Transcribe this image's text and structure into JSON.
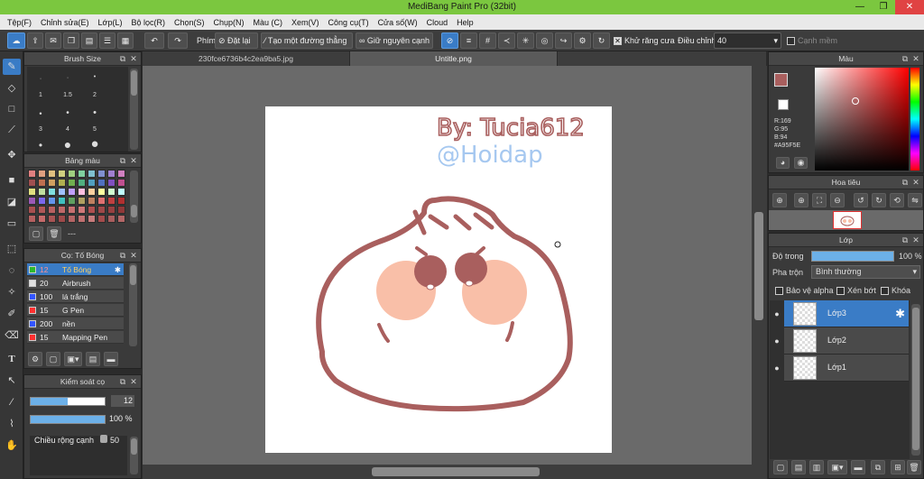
{
  "window": {
    "title": "MediBang Paint Pro (32bit)",
    "minimize": "—",
    "maximize": "❐",
    "close": "✕"
  },
  "menu": [
    "Tệp(F)",
    "Chỉnh sửa(E)",
    "Lớp(L)",
    "Bộ lọc(R)",
    "Chọn(S)",
    "Chụp(N)",
    "Màu (C)",
    "Xem(V)",
    "Công cụ(T)",
    "Cửa số(W)",
    "Cloud",
    "Help"
  ],
  "toolbar": {
    "phim_label": "Phím",
    "reset_label": "Đặt lại",
    "straight_line_label": "Tạo một đường thẳng",
    "keep_edge_label": "Giữ nguyên cạnh",
    "antialias_label": "Khử răng cưa",
    "adjust_label": "Điều chỉnh",
    "adjust_value": "40",
    "edge_label": "Cạnh mềm"
  },
  "tabs": [
    {
      "label": "230fce6736b4c2ea9ba5.jpg"
    },
    {
      "label": "Untitle.png"
    }
  ],
  "brush_size": {
    "title": "Brush Size",
    "sizes": [
      "1",
      "1.5",
      "2",
      "3",
      "4",
      "5"
    ]
  },
  "palette": {
    "title": "Bảng màu",
    "extra_label": "---",
    "colors": [
      "#e08080",
      "#e0a080",
      "#e0c080",
      "#d0d080",
      "#a0d080",
      "#80d0a0",
      "#80c0d0",
      "#8090d0",
      "#a080d0",
      "#d080c0",
      "#a05050",
      "#c07050",
      "#d0a060",
      "#b0b050",
      "#70b050",
      "#50b080",
      "#50a0c0",
      "#5070c0",
      "#8050c0",
      "#c05090",
      "#e0e080",
      "#c0e0a0",
      "#80e0e0",
      "#a0c0ff",
      "#c0a0ff",
      "#ffc0e0",
      "#ffd0a0",
      "#ffffa0",
      "#d0ffd0",
      "#c0ffff",
      "#9b59b6",
      "#7b68ee",
      "#6495ed",
      "#40c0c0",
      "#60a060",
      "#b0a060",
      "#c08060",
      "#e07070",
      "#c04040",
      "#b03030",
      "#a85050",
      "#b05858",
      "#b86060",
      "#c06868",
      "#c87070",
      "#d07878",
      "#b05050",
      "#a04848",
      "#984040",
      "#903838",
      "#b56060",
      "#c56a6a",
      "#a85454",
      "#9e4a4a",
      "#b46464",
      "#c07070",
      "#c87c7c",
      "#a44c4c",
      "#a95e5e",
      "#b36666"
    ]
  },
  "brush_panel": {
    "title": "Cọ: Tố Bóng",
    "items": [
      {
        "color": "#2db82d",
        "size": "12",
        "name": "Tố Bóng",
        "selected": true
      },
      {
        "color": "#e0e0e0",
        "size": "20",
        "name": "Airbrush",
        "selected": false
      },
      {
        "color": "#3355ff",
        "size": "100",
        "name": "lá trắng",
        "selected": false
      },
      {
        "color": "#ff3030",
        "size": "15",
        "name": "G Pen",
        "selected": false
      },
      {
        "color": "#3355ff",
        "size": "200",
        "name": "nền",
        "selected": false
      },
      {
        "color": "#ff3030",
        "size": "15",
        "name": "Mapping Pen",
        "selected": false
      }
    ]
  },
  "brush_control": {
    "title": "Kiểm soát cọ",
    "size_value": "12",
    "size_fraction": 0.5,
    "opacity_value": "100 %",
    "opacity_fraction": 1.0,
    "edge_label": "Chiều rộng cạnh",
    "edge_value": "50"
  },
  "color_panel": {
    "title": "Màu",
    "r": "R:169",
    "g": "G:95",
    "b": "B:94",
    "hex": "#A95F5E",
    "fg": "#A95F5E"
  },
  "navigator": {
    "title": "Hoa tiêu"
  },
  "layer_panel": {
    "title": "Lớp",
    "opacity_label": "Độ trong",
    "opacity_value": "100 %",
    "opacity_fraction": 1.0,
    "blend_label": "Pha trộn",
    "blend_value": "Bình thường",
    "protect_alpha": "Bảo vệ alpha",
    "clip": "Xén bớt",
    "lock": "Khóa",
    "layers": [
      {
        "name": "Lớp3",
        "selected": true
      },
      {
        "name": "Lớp2",
        "selected": false
      },
      {
        "name": "Lớp1",
        "selected": false
      }
    ]
  },
  "artwork": {
    "signature_line1": "By: Tucia612",
    "signature_line2": "@Hoidap",
    "stroke_color": "#A95F5E",
    "cheek_color": "#F9BFA8",
    "eye_color": "#A95F5E"
  }
}
